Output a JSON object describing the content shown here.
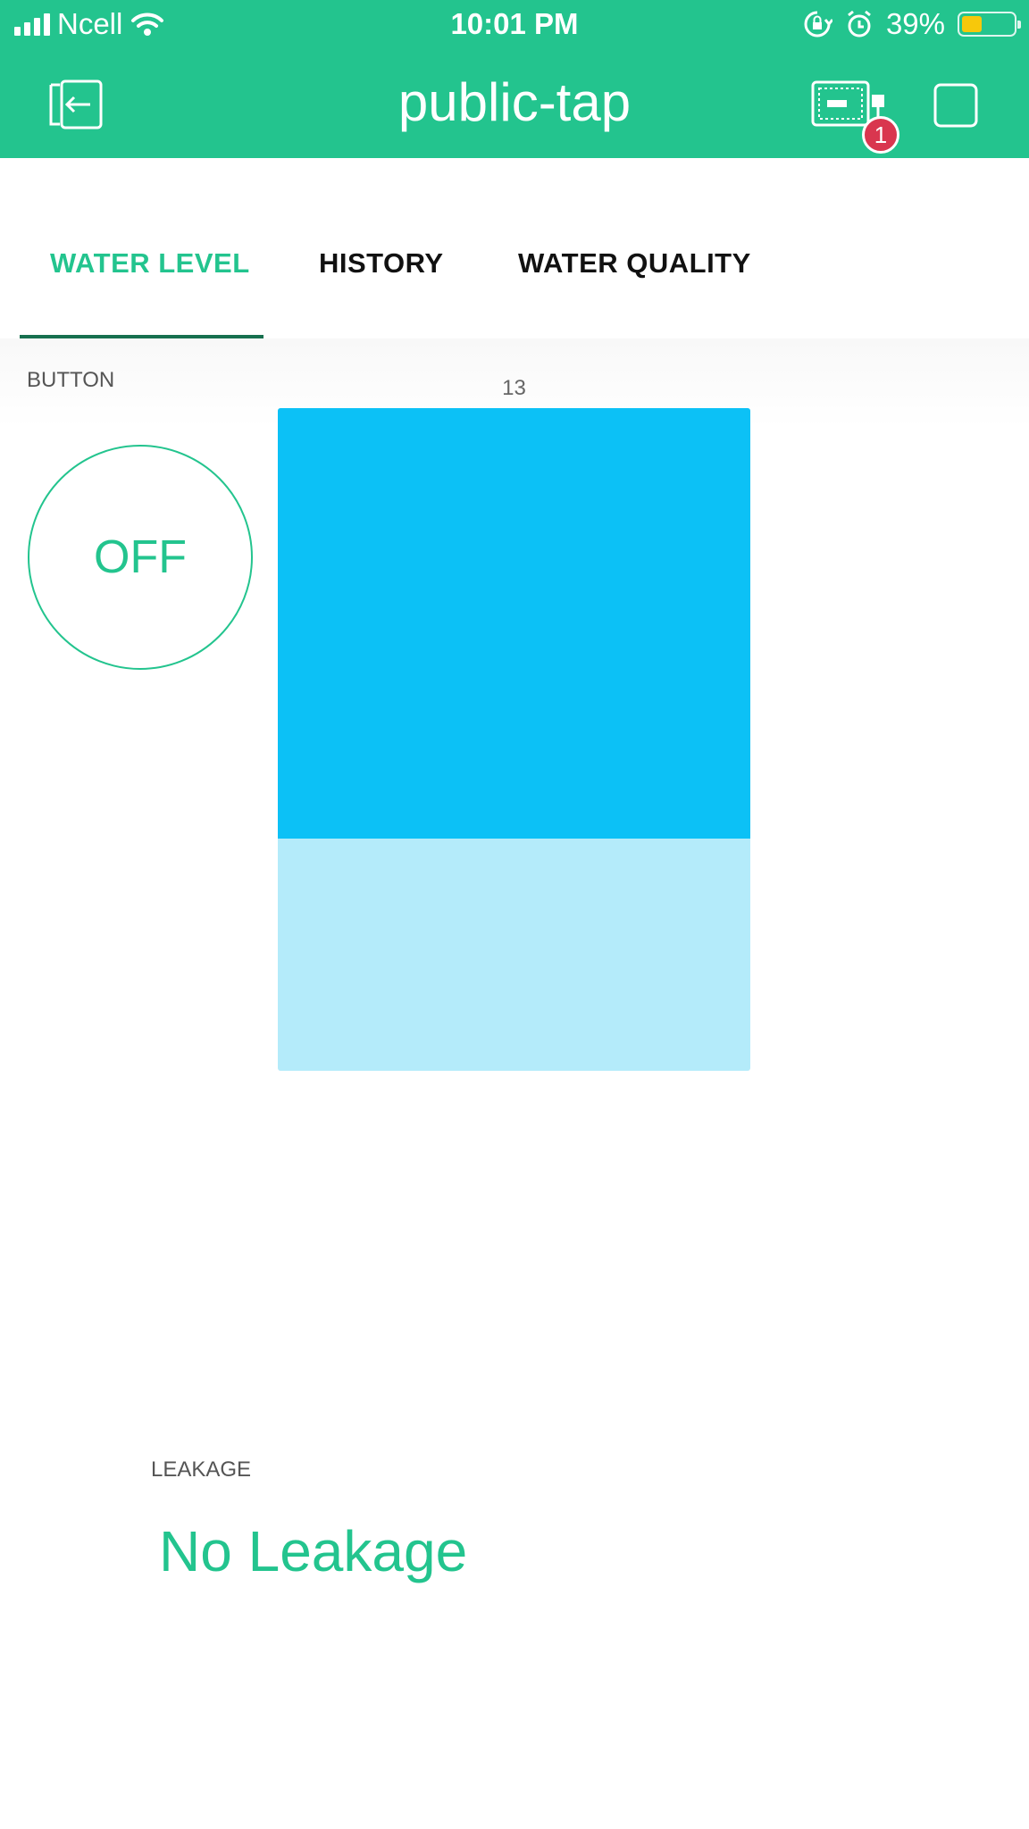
{
  "status_bar": {
    "carrier": "Ncell",
    "time": "10:01 PM",
    "battery_percent": "39%",
    "battery_level": 0.39,
    "icons": [
      "signal-icon",
      "wifi-icon",
      "rotation-lock-icon",
      "alarm-icon",
      "battery-icon"
    ]
  },
  "header": {
    "title": "public-tap",
    "notification_count": "1",
    "icons": [
      "exit-icon",
      "device-icon",
      "stop-icon"
    ],
    "background_color": "#23c48e"
  },
  "tabs": [
    {
      "label": "WATER LEVEL",
      "active": true
    },
    {
      "label": "HISTORY",
      "active": false
    },
    {
      "label": "WATER QUALITY",
      "active": false
    }
  ],
  "widgets": {
    "button": {
      "label": "BUTTON",
      "state": "OFF"
    },
    "level": {
      "value": "13",
      "fill_fraction": 0.65,
      "fill_color": "#0cc1f6",
      "track_color": "#b4ebfa"
    },
    "leakage": {
      "label": "LEAKAGE",
      "value": "No Leakage"
    }
  },
  "colors": {
    "accent": "#23c48e",
    "tab_indicator": "#17704f",
    "badge": "#d9364f"
  }
}
